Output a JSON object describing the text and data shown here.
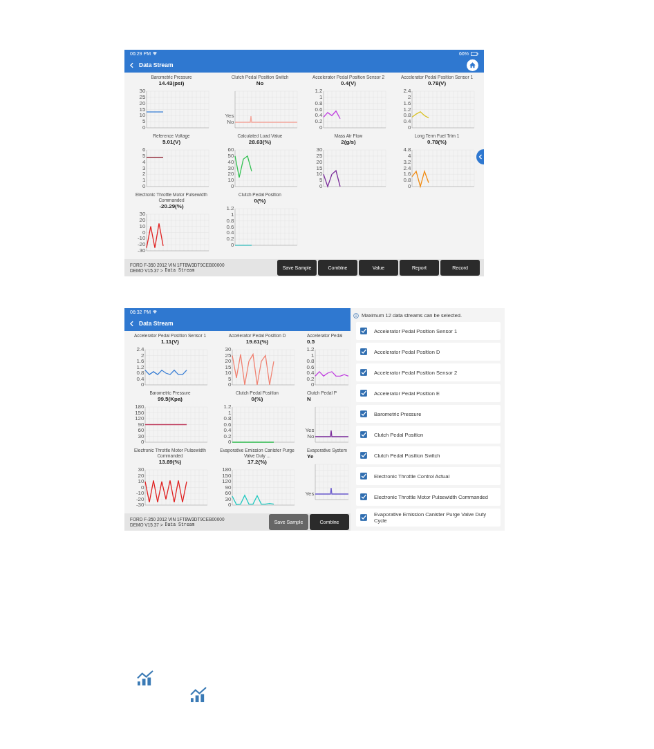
{
  "data_stream_screen": {
    "status_bar": {
      "time": "06:29 PM",
      "battery": "66%"
    },
    "title": "Data Stream",
    "panels": [
      {
        "kind": "chart",
        "title": "Barometric Pressure",
        "value": "14.43(psi)",
        "chart_data": {
          "type": "line",
          "grid": true,
          "categories": [
            null,
            null,
            null,
            null,
            null,
            null,
            null,
            null,
            null,
            null,
            null,
            null,
            null,
            null,
            null,
            null
          ],
          "ylim": [
            0,
            30
          ],
          "yticks": [
            0,
            5,
            10,
            15,
            20,
            25,
            30
          ],
          "series": [
            {
              "color": "#3a7fd5",
              "values": [
                13,
                13,
                13,
                13,
                13,
                null,
                null,
                null,
                null,
                null,
                null,
                null,
                null,
                null,
                null,
                null
              ]
            }
          ]
        }
      },
      {
        "kind": "state",
        "title": "Clutch Pedal Position Switch",
        "value": "No",
        "axis_labels": [
          "Yes",
          "No"
        ],
        "color": "#f4a59a"
      },
      {
        "kind": "chart",
        "title": "Accelerator Pedal Position Sensor 2",
        "value": "0.4(V)",
        "chart_data": {
          "type": "line",
          "grid": true,
          "categories": [
            null,
            null,
            null,
            null,
            null,
            null,
            null,
            null,
            null,
            null,
            null,
            null,
            null,
            null,
            null,
            null
          ],
          "ylim": [
            0,
            1.2
          ],
          "yticks": [
            0,
            0.2,
            0.4,
            0.6,
            0.8,
            1,
            1.2
          ],
          "series": [
            {
              "color": "#c040e0",
              "values": [
                0.35,
                0.5,
                0.4,
                0.55,
                0.3,
                null,
                null,
                null,
                null,
                null,
                null,
                null,
                null,
                null,
                null,
                null
              ]
            }
          ]
        }
      },
      {
        "kind": "chart",
        "title": "Accelerator Pedal Position Sensor 1",
        "value": "0.78(V)",
        "chart_data": {
          "type": "line",
          "grid": true,
          "categories": [
            null,
            null,
            null,
            null,
            null,
            null,
            null,
            null,
            null,
            null,
            null,
            null,
            null,
            null,
            null,
            null
          ],
          "ylim": [
            0,
            2.4
          ],
          "yticks": [
            0,
            0.4,
            0.8,
            1.2,
            1.6,
            2,
            2.4
          ],
          "series": [
            {
              "color": "#d8c020",
              "values": [
                0.7,
                0.9,
                1.05,
                0.8,
                0.65,
                null,
                null,
                null,
                null,
                null,
                null,
                null,
                null,
                null,
                null,
                null
              ]
            }
          ]
        }
      },
      {
        "kind": "chart",
        "title": "Reference Voltage",
        "value": "5.01(V)",
        "chart_data": {
          "type": "line",
          "grid": true,
          "categories": [
            null,
            null,
            null,
            null,
            null,
            null,
            null,
            null,
            null,
            null,
            null,
            null,
            null,
            null,
            null,
            null
          ],
          "ylim": [
            0,
            6
          ],
          "yticks": [
            0,
            1,
            2,
            3,
            4,
            5,
            6
          ],
          "series": [
            {
              "color": "#8b1a2a",
              "values": [
                4.8,
                4.8,
                4.8,
                4.8,
                4.8,
                null,
                null,
                null,
                null,
                null,
                null,
                null,
                null,
                null,
                null,
                null
              ]
            }
          ]
        }
      },
      {
        "kind": "chart",
        "title": "Calculated Load Value",
        "value": "28.63(%)",
        "chart_data": {
          "type": "line",
          "grid": true,
          "categories": [
            null,
            null,
            null,
            null,
            null,
            null,
            null,
            null,
            null,
            null,
            null,
            null,
            null,
            null,
            null,
            null
          ],
          "ylim": [
            0,
            60
          ],
          "yticks": [
            0,
            10,
            20,
            30,
            40,
            50,
            60
          ],
          "series": [
            {
              "color": "#30c050",
              "values": [
                50,
                15,
                45,
                50,
                25,
                null,
                null,
                null,
                null,
                null,
                null,
                null,
                null,
                null,
                null,
                null
              ]
            }
          ]
        }
      },
      {
        "kind": "chart",
        "title": "Mass Air Flow",
        "value": "2(g/s)",
        "chart_data": {
          "type": "line",
          "grid": true,
          "categories": [
            null,
            null,
            null,
            null,
            null,
            null,
            null,
            null,
            null,
            null,
            null,
            null,
            null,
            null,
            null,
            null
          ],
          "ylim": [
            0,
            30
          ],
          "yticks": [
            0,
            5,
            10,
            15,
            20,
            25,
            30
          ],
          "series": [
            {
              "color": "#7a2a9a",
              "values": [
                10,
                0,
                10,
                13,
                0,
                null,
                null,
                null,
                null,
                null,
                null,
                null,
                null,
                null,
                null,
                null
              ]
            }
          ]
        }
      },
      {
        "kind": "chart",
        "title": "Long Term Fuel Trim 1",
        "value": "0.78(%)",
        "chart_data": {
          "type": "line",
          "grid": true,
          "categories": [
            null,
            null,
            null,
            null,
            null,
            null,
            null,
            null,
            null,
            null,
            null,
            null,
            null,
            null,
            null,
            null
          ],
          "ylim": [
            0,
            4.8
          ],
          "yticks": [
            0,
            0.8,
            1.6,
            2.4,
            3.2,
            4,
            4.8
          ],
          "series": [
            {
              "color": "#f08a10",
              "values": [
                1.3,
                2,
                0,
                2,
                0.5,
                null,
                null,
                null,
                null,
                null,
                null,
                null,
                null,
                null,
                null,
                null
              ]
            }
          ]
        }
      },
      {
        "kind": "chart",
        "title": "Electronic Throttle Motor Pulsewidth Commanded",
        "value": "-20.29(%)",
        "chart_data": {
          "type": "line",
          "grid": true,
          "categories": [
            null,
            null,
            null,
            null,
            null,
            null,
            null,
            null,
            null,
            null,
            null,
            null,
            null,
            null,
            null,
            null
          ],
          "ylim": [
            -30,
            30
          ],
          "yticks": [
            -30,
            -20,
            -10,
            0,
            10,
            20,
            30
          ],
          "series": [
            {
              "color": "#e02020",
              "values": [
                -25,
                10,
                -25,
                15,
                -22,
                null,
                null,
                null,
                null,
                null,
                null,
                null,
                null,
                null,
                null,
                null
              ]
            }
          ]
        }
      },
      {
        "kind": "chart",
        "title": "Clutch Pedal Position",
        "value": "0(%)",
        "chart_data": {
          "type": "line",
          "grid": true,
          "categories": [
            null,
            null,
            null,
            null,
            null,
            null,
            null,
            null,
            null,
            null,
            null,
            null,
            null,
            null,
            null,
            null
          ],
          "ylim": [
            0,
            1.2
          ],
          "yticks": [
            0,
            0.2,
            0.4,
            0.6,
            0.8,
            1,
            1.2
          ],
          "series": [
            {
              "color": "#40c8c8",
              "values": [
                0,
                0,
                0,
                0,
                0,
                null,
                null,
                null,
                null,
                null,
                null,
                null,
                null,
                null,
                null,
                null
              ]
            }
          ]
        }
      }
    ],
    "vehicle": "FORD  F-350  2012  VIN  1FT8W3DT9CEB00000",
    "version": "DEMO V15.37 >",
    "path": "Data Stream",
    "buttons": [
      "Save Sample",
      "Combine",
      "Value",
      "Report",
      "Record"
    ]
  },
  "selection_screen": {
    "status_bar": {
      "time": "06:32 PM"
    },
    "title": "Data Stream",
    "panels": [
      {
        "kind": "chart",
        "title": "Accelerator Pedal Position Sensor 1",
        "value": "1.11(V)",
        "chart_data": {
          "type": "line",
          "grid": true,
          "categories": [
            null,
            null,
            null,
            null,
            null,
            null,
            null,
            null,
            null,
            null,
            null,
            null,
            null,
            null,
            null,
            null
          ],
          "ylim": [
            0,
            2.4
          ],
          "yticks": [
            0,
            0.4,
            0.8,
            1.2,
            1.6,
            2,
            2.4
          ],
          "series": [
            {
              "color": "#3a7fd5",
              "values": [
                1,
                0.7,
                0.9,
                0.7,
                1,
                0.8,
                0.7,
                1,
                0.7,
                0.7,
                1,
                null,
                null,
                null,
                null,
                null
              ]
            }
          ]
        }
      },
      {
        "kind": "chart",
        "title": "Accelerator Pedal Position D",
        "value": "19.61(%)",
        "chart_data": {
          "type": "line",
          "grid": true,
          "categories": [
            null,
            null,
            null,
            null,
            null,
            null,
            null,
            null,
            null,
            null,
            null,
            null,
            null,
            null,
            null,
            null
          ],
          "ylim": [
            0,
            30
          ],
          "yticks": [
            0,
            5,
            10,
            15,
            20,
            25,
            30
          ],
          "series": [
            {
              "color": "#f08070",
              "values": [
                25,
                6,
                26,
                0,
                20,
                26,
                0,
                20,
                25,
                0,
                20,
                null,
                null,
                null,
                null,
                null
              ]
            }
          ]
        }
      },
      {
        "kind": "chart",
        "title": "Accelerator Pedal",
        "value": "0.5",
        "chart_data": {
          "type": "line",
          "grid": true,
          "categories": [
            null,
            null,
            null,
            null,
            null,
            null,
            null,
            null,
            null
          ],
          "ylim": [
            0,
            1.2
          ],
          "yticks": [
            0,
            0.2,
            0.4,
            0.6,
            0.8,
            1,
            1.2
          ],
          "series": [
            {
              "color": "#c040e0",
              "values": [
                0.3,
                0.45,
                0.3,
                0.4,
                0.45,
                0.3,
                0.3,
                0.35,
                0.3
              ]
            }
          ]
        }
      },
      {
        "kind": "chart",
        "title": "Barometric Pressure",
        "value": "99.5(Kpa)",
        "chart_data": {
          "type": "line",
          "grid": true,
          "categories": [
            null,
            null,
            null,
            null,
            null,
            null,
            null,
            null,
            null,
            null,
            null,
            null,
            null,
            null,
            null,
            null
          ],
          "ylim": [
            0,
            180
          ],
          "yticks": [
            0,
            30,
            60,
            90,
            120,
            150,
            180
          ],
          "series": [
            {
              "color": "#c04060",
              "values": [
                90,
                90,
                90,
                90,
                90,
                90,
                90,
                90,
                90,
                90,
                90,
                null,
                null,
                null,
                null,
                null
              ]
            }
          ]
        }
      },
      {
        "kind": "chart",
        "title": "Clutch Pedal Position",
        "value": "0(%)",
        "chart_data": {
          "type": "line",
          "grid": true,
          "categories": [
            null,
            null,
            null,
            null,
            null,
            null,
            null,
            null,
            null,
            null,
            null,
            null,
            null,
            null,
            null,
            null
          ],
          "ylim": [
            0,
            1.2
          ],
          "yticks": [
            0,
            0.2,
            0.4,
            0.6,
            0.8,
            1,
            1.2
          ],
          "series": [
            {
              "color": "#30c050",
              "values": [
                0,
                0,
                0,
                0,
                0,
                0,
                0,
                0,
                0,
                0,
                0,
                null,
                null,
                null,
                null,
                null
              ]
            }
          ]
        }
      },
      {
        "kind": "state",
        "title": "Clutch Pedal P",
        "value": "N",
        "axis_labels": [
          "Yes",
          "No"
        ],
        "color": "#7a2a9a"
      },
      {
        "kind": "chart",
        "title": "Electronic Throttle Motor Pulsewidth Commanded",
        "value": "13.89(%)",
        "chart_data": {
          "type": "line",
          "grid": true,
          "categories": [
            null,
            null,
            null,
            null,
            null,
            null,
            null,
            null,
            null,
            null,
            null,
            null,
            null,
            null,
            null,
            null
          ],
          "ylim": [
            -30,
            30
          ],
          "yticks": [
            -30,
            -20,
            -10,
            0,
            10,
            20,
            30
          ],
          "series": [
            {
              "color": "#e02020",
              "values": [
                10,
                -25,
                12,
                -25,
                10,
                -20,
                12,
                -25,
                12,
                -25,
                10,
                null,
                null,
                null,
                null,
                null
              ]
            }
          ]
        }
      },
      {
        "kind": "chart",
        "title": "Evaporative Emission Canister Purge Valve Duty ...",
        "value": "17.2(%)",
        "chart_data": {
          "type": "line",
          "grid": true,
          "categories": [
            null,
            null,
            null,
            null,
            null,
            null,
            null,
            null,
            null,
            null,
            null,
            null,
            null,
            null,
            null,
            null
          ],
          "ylim": [
            0,
            180
          ],
          "yticks": [
            0,
            30,
            60,
            90,
            120,
            150,
            180
          ],
          "series": [
            {
              "color": "#20c8c0",
              "values": [
                45,
                2,
                5,
                50,
                5,
                5,
                48,
                5,
                5,
                8,
                5,
                null,
                null,
                null,
                null,
                null
              ]
            }
          ]
        }
      },
      {
        "kind": "state",
        "title": "Evaporative System",
        "value": "Ye",
        "axis_labels": [
          "Yes"
        ],
        "color": "#6a5acd"
      }
    ],
    "vehicle": "FORD  F-350  2012  VIN  1FT8W3DT9CEB00000",
    "version": "DEMO V15.37 >",
    "path": "Data Stream",
    "buttons": [
      "Save Sample",
      "Combine"
    ],
    "notice": "Maximum 12 data streams can be selected.",
    "items": [
      {
        "label": "Accelerator Pedal Position Sensor 1",
        "checked": true
      },
      {
        "label": "Accelerator Pedal Position D",
        "checked": true
      },
      {
        "label": "Accelerator Pedal Position Sensor 2",
        "checked": true
      },
      {
        "label": "Accelerator Pedal Position E",
        "checked": true
      },
      {
        "label": "Barometric Pressure",
        "checked": true
      },
      {
        "label": "Clutch Pedal Position",
        "checked": true
      },
      {
        "label": "Clutch Pedal Position Switch",
        "checked": true
      },
      {
        "label": "Electronic Throttle Control Actual",
        "checked": true
      },
      {
        "label": "Electronic Throttle Motor Pulsewidth Commanded",
        "checked": true
      },
      {
        "label": "Evaporative Emission Canister Purge Valve Duty Cycle",
        "checked": true
      }
    ]
  }
}
